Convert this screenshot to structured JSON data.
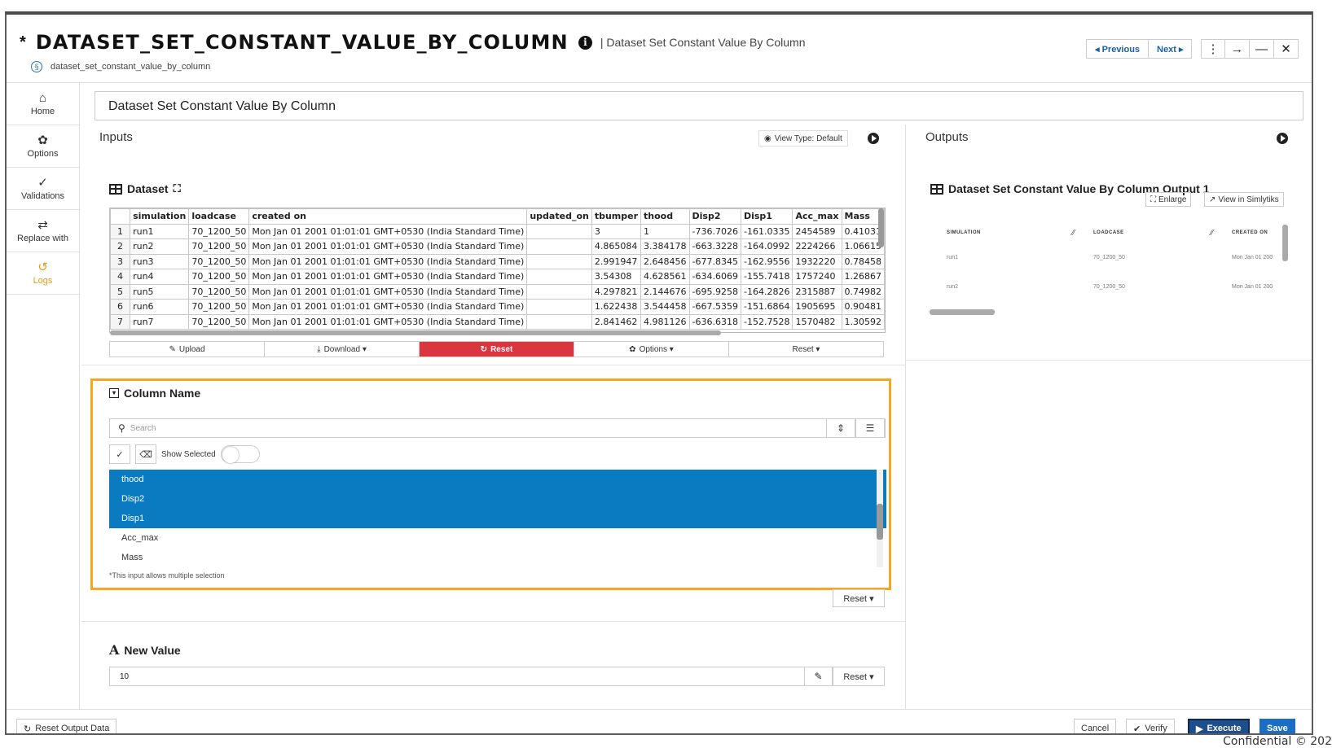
{
  "header": {
    "asterisk": "*",
    "title": "DATASET_SET_CONSTANT_VALUE_BY_COLUMN",
    "subtitle": "| Dataset Set Constant Value By Column",
    "tool_id": "dataset_set_constant_value_by_column",
    "previous_label": "◂ Previous",
    "next_label": "Next ▸"
  },
  "sidebar": {
    "items": [
      {
        "label": "Home",
        "icon": "home-icon"
      },
      {
        "label": "Options",
        "icon": "gear-icon"
      },
      {
        "label": "Validations",
        "icon": "check-double-icon"
      },
      {
        "label": "Replace with",
        "icon": "swap-icon"
      },
      {
        "label": "Logs",
        "icon": "history-icon"
      }
    ]
  },
  "tool_title": "Dataset Set Constant Value By Column",
  "inputs": {
    "title": "Inputs",
    "view_type": "View Type: Default",
    "dataset_label": "Dataset",
    "table": {
      "headers": [
        "",
        "simulation",
        "loadcase",
        "created on",
        "updated_on",
        "tbumper",
        "thood",
        "Disp2",
        "Disp1",
        "Acc_max",
        "Mass"
      ],
      "rows": [
        [
          "1",
          "run1",
          "70_1200_50",
          "Mon Jan 01 2001 01:01:01 GMT+0530 (India Standard Time)",
          "",
          "3",
          "1",
          "-736.7026",
          "-161.0335",
          "2454589",
          "0.41031"
        ],
        [
          "2",
          "run2",
          "70_1200_50",
          "Mon Jan 01 2001 01:01:01 GMT+0530 (India Standard Time)",
          "",
          "4.865084",
          "3.384178",
          "-663.3228",
          "-164.0992",
          "2224266",
          "1.06615"
        ],
        [
          "3",
          "run3",
          "70_1200_50",
          "Mon Jan 01 2001 01:01:01 GMT+0530 (India Standard Time)",
          "",
          "2.991947",
          "2.648456",
          "-677.8345",
          "-162.9556",
          "1932220",
          "0.78458"
        ],
        [
          "4",
          "run4",
          "70_1200_50",
          "Mon Jan 01 2001 01:01:01 GMT+0530 (India Standard Time)",
          "",
          "3.54308",
          "4.628561",
          "-634.6069",
          "-155.7418",
          "1757240",
          "1.26867"
        ],
        [
          "5",
          "run5",
          "70_1200_50",
          "Mon Jan 01 2001 01:01:01 GMT+0530 (India Standard Time)",
          "",
          "4.297821",
          "2.144676",
          "-695.9258",
          "-164.2826",
          "2315887",
          "0.74982"
        ],
        [
          "6",
          "run6",
          "70_1200_50",
          "Mon Jan 01 2001 01:01:01 GMT+0530 (India Standard Time)",
          "",
          "1.622438",
          "3.544458",
          "-667.5359",
          "-151.6864",
          "1905695",
          "0.90481"
        ],
        [
          "7",
          "run7",
          "70_1200_50",
          "Mon Jan 01 2001 01:01:01 GMT+0530 (India Standard Time)",
          "",
          "2.841462",
          "4.981126",
          "-636.6318",
          "-152.7528",
          "1570482",
          "1.30592"
        ]
      ]
    },
    "actions": {
      "upload": "Upload",
      "download": "Download ▾",
      "reset_red": "Reset",
      "options": "Options ▾",
      "reset": "Reset ▾"
    }
  },
  "column_name": {
    "label": "Column Name",
    "search_placeholder": "Search",
    "show_selected": "Show Selected",
    "items": [
      {
        "label": "thood",
        "selected": true
      },
      {
        "label": "Disp2",
        "selected": true
      },
      {
        "label": "Disp1",
        "selected": true
      },
      {
        "label": "Acc_max",
        "selected": false
      },
      {
        "label": "Mass",
        "selected": false
      }
    ],
    "note": "*This input allows multiple selection",
    "reset": "Reset ▾"
  },
  "new_value": {
    "label": "New Value",
    "value": "10",
    "reset": "Reset ▾"
  },
  "outputs": {
    "title": "Outputs",
    "output_label": "Dataset Set Constant Value By Column Output 1",
    "enlarge": "Enlarge",
    "view_in": "View in Simlytiks",
    "headers": [
      "SIMULATION",
      "LOADCASE",
      "CREATED ON"
    ],
    "rows": [
      [
        "run1",
        "70_1200_50",
        "Mon Jan 01 200"
      ],
      [
        "run2",
        "70_1200_50",
        "Mon Jan 01 200"
      ]
    ]
  },
  "footer": {
    "reset_output": "Reset Output Data",
    "cancel": "Cancel",
    "verify": "Verify",
    "execute": "Execute",
    "save": "Save"
  },
  "confidential": "Confidential  © 202",
  "colors": {
    "accent_orange": "#f5a623",
    "selection_blue": "#0a7bc1",
    "reset_red": "#d9363e",
    "save_blue": "#1a6fc4"
  }
}
